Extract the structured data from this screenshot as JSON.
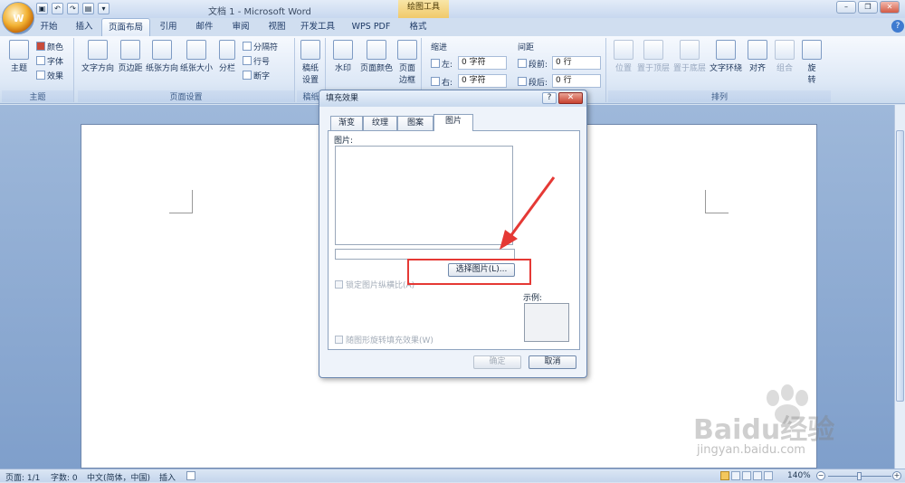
{
  "window": {
    "title": "文档 1 - Microsoft Word",
    "context_tools": "绘图工具"
  },
  "tabs": [
    "开始",
    "插入",
    "页面布局",
    "引用",
    "邮件",
    "审阅",
    "视图",
    "开发工具",
    "WPS PDF",
    "格式"
  ],
  "ribbon": {
    "theme_group": {
      "label": "主题",
      "theme": "主题",
      "colors": "颜色",
      "fonts": "字体",
      "effects": "效果"
    },
    "page_setup": {
      "label": "页面设置",
      "text_direction": "文字方向",
      "margins": "页边距",
      "orientation": "纸张方向",
      "size": "纸张大小",
      "columns": "分栏",
      "breaks": "分隔符",
      "line_numbers": "行号",
      "hyphenation": "断字"
    },
    "paper": {
      "label": "稿纸",
      "btn": "稿纸\n设置"
    },
    "page_bg": {
      "watermark": "水印",
      "page_color": "页面颜色",
      "page_border": "页面\n边框"
    },
    "paragraph": {
      "indent": "缩进",
      "spacing": "间距",
      "left": "左:",
      "right": "右:",
      "before": "段前:",
      "after": "段后:",
      "left_val": "0 字符",
      "right_val": "0 字符",
      "before_val": "0 行",
      "after_val": "0 行"
    },
    "arrange": {
      "label": "排列",
      "position": "位置",
      "bring_front": "置于顶层",
      "send_back": "置于底层",
      "wrap": "文字环绕",
      "align": "对齐",
      "group": "组合",
      "rotate": "旋\n转"
    }
  },
  "dialog": {
    "title": "填充效果",
    "help": "?",
    "close": "✕",
    "tabs": [
      "渐变",
      "纹理",
      "图案",
      "图片"
    ],
    "picture_label": "图片:",
    "select_button": "选择图片(L)...",
    "lock_aspect": "锁定图片纵横比(A)",
    "rotate_with_shape": "随图形旋转填充效果(W)",
    "sample_label": "示例:",
    "ok": "确定",
    "cancel": "取消"
  },
  "status": {
    "page": "页面: 1/1",
    "words": "字数: 0",
    "lang": "中文(简体，中国)",
    "mode": "插入",
    "zoom": "140%"
  },
  "watermark": {
    "brand": "Baidu经验",
    "url": "jingyan.baidu.com"
  },
  "colors": {
    "accent": "#e53935",
    "ribbon": "#dde8f6",
    "doc_bg": "#8eaad3"
  }
}
